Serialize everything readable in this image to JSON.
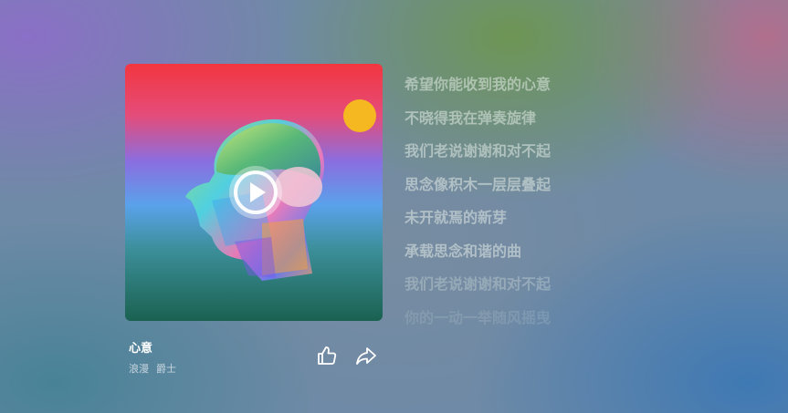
{
  "player": {
    "song_title": "心意",
    "artists": [
      "浪漫",
      "爵士"
    ],
    "cover_art": "stylized-head-portrait-cover",
    "play_icon": "play-icon",
    "like_icon": "thumbs-up-icon",
    "share_icon": "share-icon"
  },
  "lyrics": [
    "希望你能收到我的心意",
    "不晓得我在弹奏旋律",
    "我们老说谢谢和对不起",
    "思念像积木一层层叠起",
    "未开就焉的新芽",
    "承载思念和谐的曲",
    "我们老说谢谢和对不起",
    "你的一动一举随风摇曳"
  ],
  "colors": {
    "cover_top": "#f03a45",
    "cover_mid": "#5aa8e8",
    "cover_bottom": "#1e6a58",
    "sun": "#f5b820",
    "text_primary": "#ffffff"
  }
}
